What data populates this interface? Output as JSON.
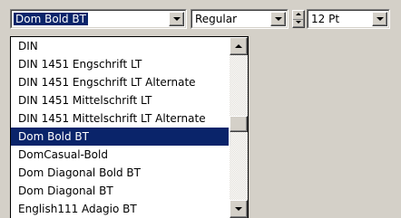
{
  "toolbar": {
    "font_name": "Dom Bold BT",
    "font_style": "Regular",
    "font_size": "12 Pt"
  },
  "font_list": {
    "selected_index": 5,
    "items": [
      "DIN",
      "DIN 1451 Engschrift LT",
      "DIN 1451 Engschrift LT Alternate",
      "DIN 1451 Mittelschrift LT",
      "DIN 1451 Mittelschrift LT Alternate",
      "Dom Bold BT",
      "DomCasual-Bold",
      "Dom Diagonal Bold BT",
      "Dom Diagonal BT",
      "English111 Adagio BT"
    ],
    "scroll_position": 0.47
  },
  "colors": {
    "face": "#d4d0c8",
    "highlight": "#0a246a",
    "highlight_text": "#ffffff"
  }
}
